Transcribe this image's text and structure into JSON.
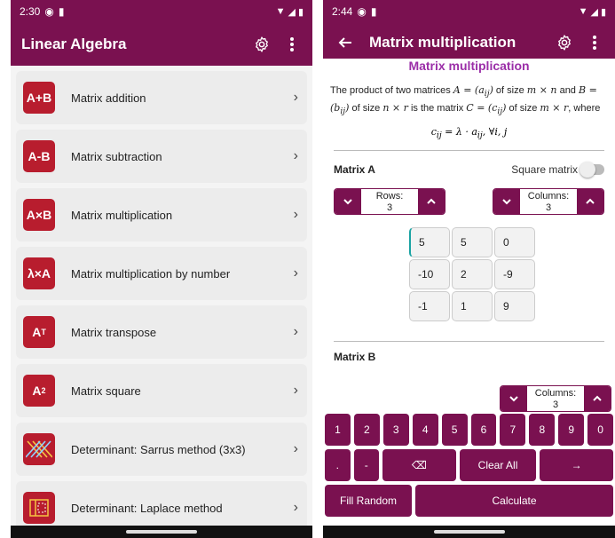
{
  "left": {
    "status": {
      "time": "2:30"
    },
    "appbar": {
      "title": "Linear Algebra"
    },
    "items": [
      {
        "icon": "A+B",
        "label": "Matrix addition"
      },
      {
        "icon": "A-B",
        "label": "Matrix subtraction"
      },
      {
        "icon": "A×B",
        "label": "Matrix multiplication"
      },
      {
        "icon": "λ×A",
        "label": "Matrix multiplication by number"
      },
      {
        "icon": "A",
        "sup": "T",
        "label": "Matrix transpose"
      },
      {
        "icon": "A",
        "sup": "2",
        "label": "Matrix square"
      },
      {
        "icon": "sarrus-icon",
        "label": "Determinant: Sarrus method (3x3)"
      },
      {
        "icon": "laplace-icon",
        "label": "Determinant: Laplace method"
      }
    ]
  },
  "right": {
    "status": {
      "time": "2:44"
    },
    "appbar": {
      "title": "Matrix multiplication"
    },
    "section_title": "Matrix multiplication",
    "desc": {
      "p1": "The product of two matrices ",
      "m1": "A = (a",
      "m1sub": "ij",
      "m1end": ")",
      "p2": " of size ",
      "m2": "m × n",
      "p3": " and ",
      "m3": "B = (b",
      "m3sub": "ij",
      "m3end": ")",
      "p4": " of size ",
      "m4": "n × r",
      "p5": " is the matrix ",
      "m5": "C = (c",
      "m5sub": "ij",
      "m5end": ")",
      "p6": " of size ",
      "m6": "m × r",
      "p7": ", where"
    },
    "formula": "c",
    "formula_sub": "ij",
    "formula_rest": " = λ · a",
    "formula_sub2": "ij",
    "formula_end": ", ∀i, j",
    "matrix_a": {
      "label": "Matrix A",
      "square_label": "Square matrix",
      "rows_label": "Rows:",
      "rows_value": "3",
      "cols_label": "Columns:",
      "cols_value": "3",
      "cells": [
        "5",
        "5",
        "0",
        "-10",
        "2",
        "-9",
        "-1",
        "1",
        "9"
      ]
    },
    "matrix_b": {
      "label": "Matrix B",
      "cols_label": "Columns:",
      "cols_value": "3"
    },
    "keyboard": {
      "digits": [
        "1",
        "2",
        "3",
        "4",
        "5",
        "6",
        "7",
        "8",
        "9",
        "0"
      ],
      "dot": ".",
      "minus": "-",
      "backspace": "⌫",
      "clear_all": "Clear All",
      "enter": "→",
      "fill_random": "Fill Random",
      "calculate": "Calculate"
    }
  },
  "colors": {
    "primary": "#7a1150",
    "tile": "#b81d2e",
    "title_purple": "#9b2fa8"
  }
}
